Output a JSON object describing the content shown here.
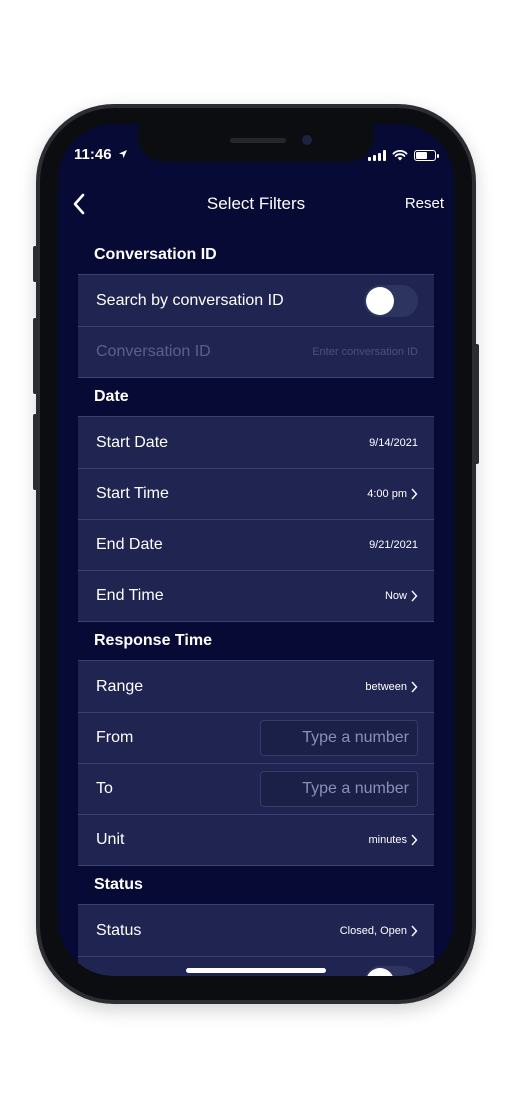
{
  "status_bar": {
    "time": "11:46"
  },
  "nav": {
    "title": "Select Filters",
    "reset_label": "Reset"
  },
  "sections": {
    "conversation_id": {
      "header": "Conversation ID",
      "search_toggle_label": "Search by conversation ID",
      "search_toggle_on": false,
      "field_label": "Conversation ID",
      "field_placeholder": "Enter conversation ID"
    },
    "date": {
      "header": "Date",
      "start_date_label": "Start Date",
      "start_date_value": "9/14/2021",
      "start_time_label": "Start Time",
      "start_time_value": "4:00 pm",
      "end_date_label": "End Date",
      "end_date_value": "9/21/2021",
      "end_time_label": "End Time",
      "end_time_value": "Now"
    },
    "response_time": {
      "header": "Response Time",
      "range_label": "Range",
      "range_value": "between",
      "from_label": "From",
      "from_placeholder": "Type a number",
      "to_label": "To",
      "to_placeholder": "Type a number",
      "unit_label": "Unit",
      "unit_value": "minutes"
    },
    "status": {
      "header": "Status",
      "status_label": "Status",
      "status_value": "Closed, Open"
    }
  },
  "colors": {
    "background": "#080a36",
    "row_background": "#1f2550",
    "separator": "#3a4170",
    "text": "#ffffff"
  },
  "icons": [
    "chevron-left-icon",
    "chevron-right-icon",
    "signal-icon",
    "wifi-icon",
    "battery-icon",
    "location-arrow-icon"
  ]
}
